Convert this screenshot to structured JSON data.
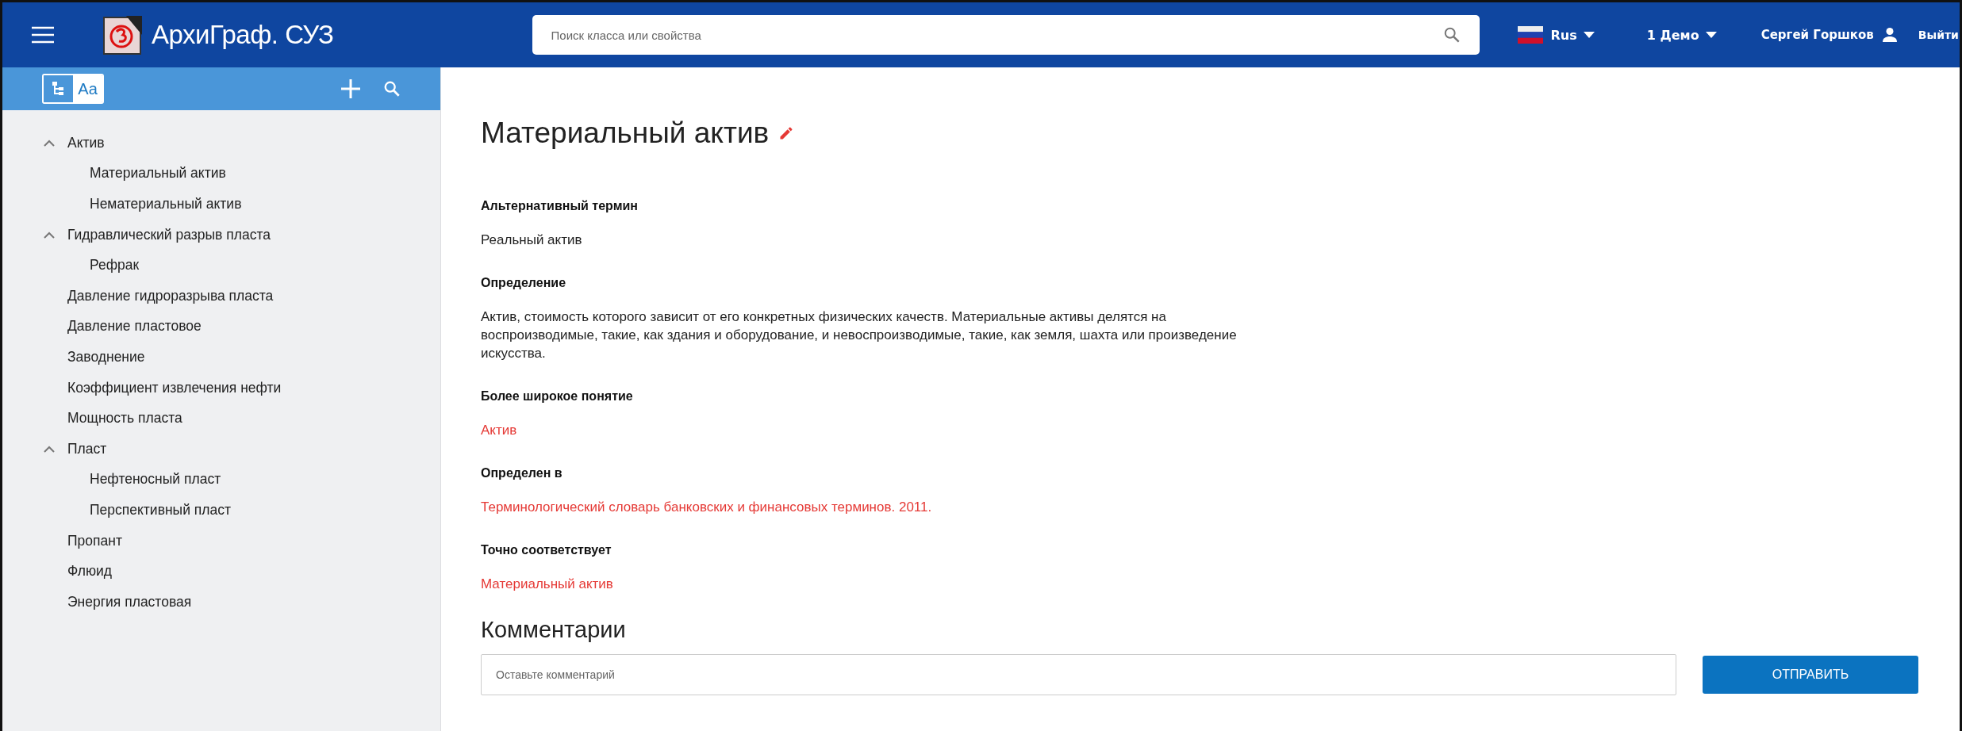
{
  "header": {
    "app_title": "АрхиГраф. СУЗ",
    "search": {
      "placeholder": "Поиск класса или свойства"
    },
    "language": "Rus",
    "workspace": "1 Демо",
    "user": "Сергей Горшков",
    "logout": "Выйти"
  },
  "sidebar": {
    "view_toggle": [
      {
        "kind": "tree",
        "selected": true
      },
      {
        "kind": "alpha",
        "label": "Аа",
        "selected": false
      }
    ],
    "tree": [
      {
        "label": "Актив",
        "expanded": true,
        "children": [
          {
            "label": "Материальный актив"
          },
          {
            "label": "Нематериальный актив"
          }
        ]
      },
      {
        "label": "Гидравлический разрыв пласта",
        "expanded": true,
        "children": [
          {
            "label": "Рефрак"
          }
        ]
      },
      {
        "label": "Давление гидроразрыва пласта"
      },
      {
        "label": "Давление пластовое"
      },
      {
        "label": "Заводнение"
      },
      {
        "label": "Коэффициент извлечения нефти"
      },
      {
        "label": "Мощность пласта"
      },
      {
        "label": "Пласт",
        "expanded": true,
        "children": [
          {
            "label": "Нефтеносный пласт"
          },
          {
            "label": "Перспективный пласт"
          }
        ]
      },
      {
        "label": "Пропант"
      },
      {
        "label": "Флюид"
      },
      {
        "label": "Энергия пластовая"
      }
    ]
  },
  "content": {
    "title": "Материальный актив",
    "properties": [
      {
        "label": "Альтернативный термин",
        "kind": "text",
        "value": "Реальный актив"
      },
      {
        "label": "Определение",
        "kind": "text",
        "value": "Актив, стоимость которого зависит от его конкретных физических качеств. Материальные активы делятся на воспроизводимые, такие, как здания и оборудование, и невоспроизводимые, такие, как земля, шахта или произведение искусства."
      },
      {
        "label": "Более широкое понятие",
        "kind": "link",
        "value": "Актив"
      },
      {
        "label": "Определен в",
        "kind": "link",
        "value": "Терминологический словарь банковских и финансовых терминов. 2011."
      },
      {
        "label": "Точно соответствует",
        "kind": "link",
        "value": "Материальный актив"
      }
    ],
    "comments": {
      "title": "Комментарии",
      "placeholder": "Оставьте комментарий",
      "submit": "ОТПРАВИТЬ"
    }
  }
}
